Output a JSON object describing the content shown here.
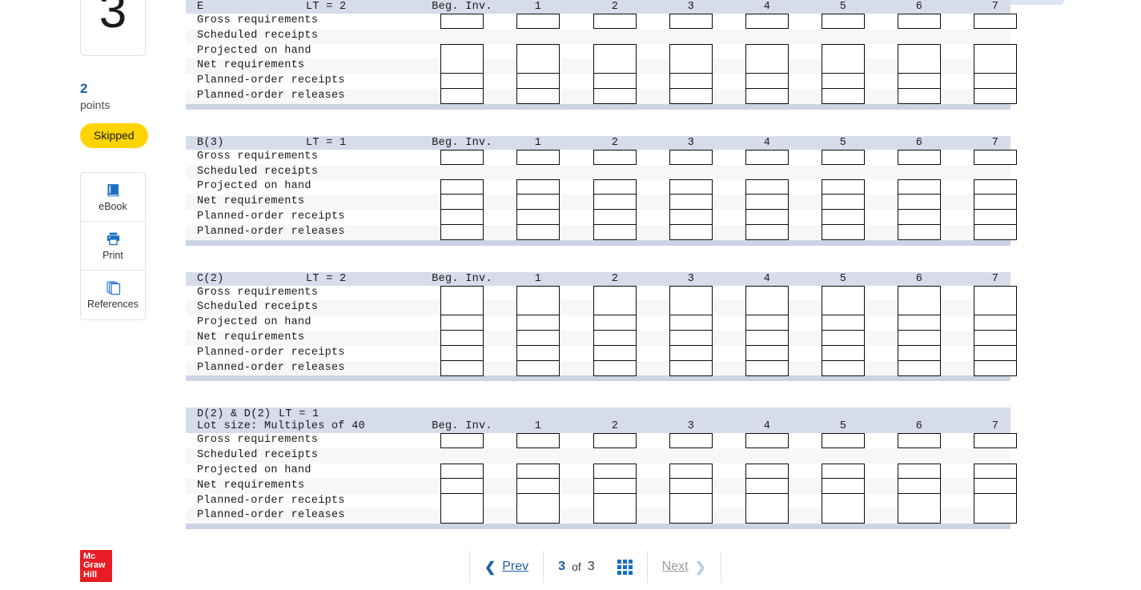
{
  "question": {
    "number": "3",
    "points_value": "2",
    "points_label": "points",
    "status": "Skipped"
  },
  "tools": [
    {
      "label": "eBook",
      "icon": "book-icon"
    },
    {
      "label": "Print",
      "icon": "printer-icon"
    },
    {
      "label": "References",
      "icon": "copy-pages-icon"
    }
  ],
  "worksheet": {
    "columns": [
      "Beg. Inv.",
      "1",
      "2",
      "3",
      "4",
      "5",
      "6",
      "7"
    ],
    "row_labels": [
      "Gross requirements",
      "Scheduled receipts",
      "Projected on hand",
      "Net requirements",
      "Planned-order receipts",
      "Planned-order releases"
    ],
    "tables": [
      {
        "name": "E",
        "lt": "LT = 2",
        "subtitle": "",
        "rows_with_inputs": [
          true,
          false,
          true,
          true,
          true,
          true
        ]
      },
      {
        "name": "B(3)",
        "lt": "LT = 1",
        "subtitle": "",
        "rows_with_inputs": [
          true,
          false,
          true,
          true,
          true,
          true
        ]
      },
      {
        "name": "C(2)",
        "lt": "LT = 2",
        "subtitle": "",
        "rows_with_inputs": [
          true,
          true,
          true,
          true,
          true,
          true
        ]
      },
      {
        "name": "D(2) & D(2)",
        "lt": "LT = 1",
        "subtitle": "Lot size: Multiples of 40",
        "rows_with_inputs": [
          true,
          false,
          true,
          true,
          true,
          true
        ]
      }
    ]
  },
  "footer": {
    "logo_lines": [
      "Mc",
      "Graw",
      "Hill"
    ],
    "prev_label": "Prev",
    "next_label": "Next",
    "current_page": "3",
    "of_label": "of",
    "total_pages": "3",
    "grid_icon": "grid-icon"
  },
  "colors": {
    "header_bg": "#d6dcea",
    "separator": "#ccd4e4",
    "row_alt": "#f7f7f7",
    "accent_blue": "#1b5faa",
    "badge_yellow": "#ffd400",
    "brand_red": "#e81c24"
  }
}
